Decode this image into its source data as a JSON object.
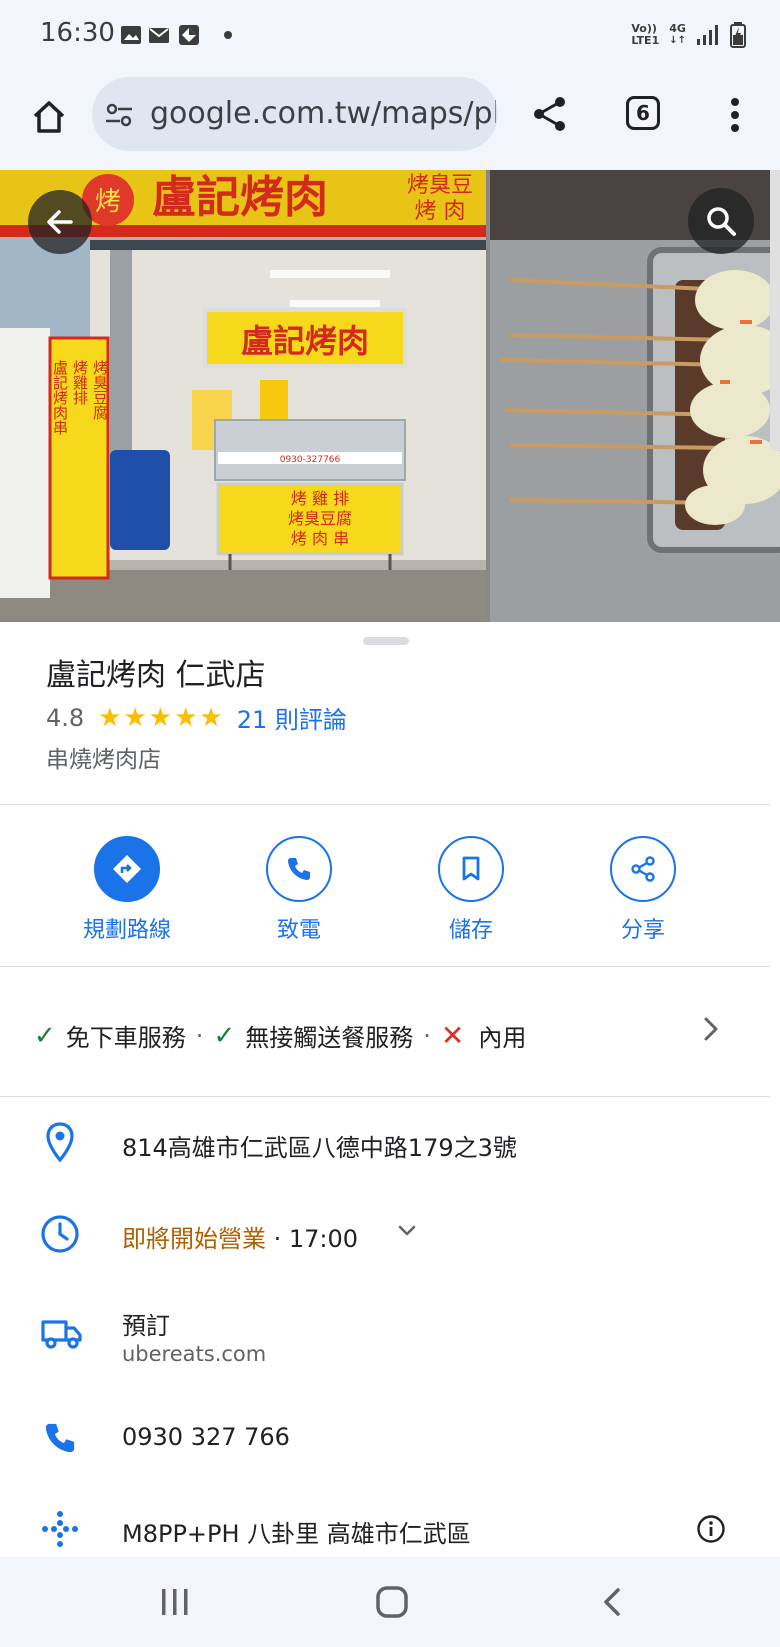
{
  "status_bar": {
    "time": "16:30",
    "left_icons": [
      "gallery-icon",
      "mail-icon",
      "app-icon",
      "dot-icon"
    ],
    "network_top": "Vo))",
    "network_bottom": "LTE1",
    "net_type": "4G"
  },
  "browser": {
    "url": "google.com.tw/maps/pla",
    "tab_count": "6"
  },
  "place": {
    "name": "盧記烤肉 仁武店",
    "rating": "4.8",
    "stars": "★★★★★",
    "reviews": "21 則評論",
    "category": "串燒烤肉店"
  },
  "photo_signs": {
    "sign_main": "盧記烤肉",
    "sign_top_right_1": "烤臭豆",
    "sign_top_right_2": "烤 肉",
    "stall_sign": "盧記烤肉",
    "stall_menu_1": "烤 雞 排",
    "stall_menu_2": "烤臭豆腐",
    "stall_menu_3": "烤 肉 串",
    "logo_char": "烤",
    "phone_strip": "0930-327766",
    "side_sign_col1": "盧記烤肉串",
    "side_sign_col2": "烤雞排",
    "side_sign_col3": "烤臭豆腐"
  },
  "actions": [
    {
      "label": "規劃路線",
      "icon": "directions-icon"
    },
    {
      "label": "致電",
      "icon": "phone-icon"
    },
    {
      "label": "儲存",
      "icon": "bookmark-icon"
    },
    {
      "label": "分享",
      "icon": "share-icon"
    }
  ],
  "service_options": [
    {
      "label": "免下車服務",
      "available": true
    },
    {
      "label": "無接觸送餐服務",
      "available": true
    },
    {
      "label": "內用",
      "available": false
    }
  ],
  "service_separator": "·",
  "details": {
    "address": "814高雄市仁武區八德中路179之3號",
    "hours_status": "即將開始營業",
    "hours_time": " · 17:00",
    "order_label": "預訂",
    "order_site": "ubereats.com",
    "phone": "0930 327 766",
    "plus_code": "M8PP+PH 八卦里 高雄市仁武區"
  },
  "colors": {
    "accent": "#1a73e8",
    "star": "#fbbc04",
    "hours": "#b06000",
    "check": "#188038",
    "cross": "#d93025"
  }
}
